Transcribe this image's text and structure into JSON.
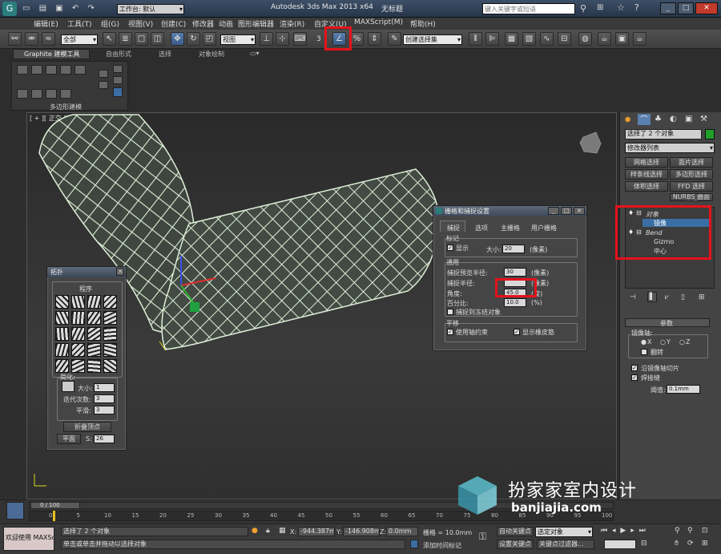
{
  "title_bar": {
    "workspace_label": "工作台: 默认",
    "app_title": "Autodesk 3ds Max  2013 x64",
    "doc_title": "无标题",
    "search_placeholder": "键入关键字或短语"
  },
  "menu": [
    "编辑(E)",
    "工具(T)",
    "组(G)",
    "视图(V)",
    "创建(C)",
    "修改器",
    "动画",
    "图形编辑器",
    "渲染(R)",
    "自定义(U)",
    "MAXScript(M)",
    "帮助(H)"
  ],
  "toolbar": {
    "filter_dropdown": "全部",
    "coord_dropdown": "视图",
    "snap_number": "3",
    "selection_set_dropdown": "创建选择集"
  },
  "ribbon": {
    "tabs": [
      "Graphite 建模工具",
      "自由形式",
      "选择",
      "对象绘制"
    ],
    "panel_label": "多边形建模"
  },
  "viewport": {
    "label": "[ + ][ 正交 ][ 真实 + 边面 ]"
  },
  "topology_panel": {
    "title": "拓扑",
    "section": "程序",
    "simplify_label": "简化:",
    "size_label": "大小:",
    "size_value": "1",
    "iter_label": "迭代次数:",
    "iter_value": "3",
    "smooth_label": "平滑:",
    "smooth_value": "3",
    "collapse_btn": "折叠顶点",
    "plane_btn": "平面",
    "s_label": "S:",
    "s_value": "26"
  },
  "grid_dialog": {
    "title": "栅格和捕捉设置",
    "tabs": [
      "捕捉",
      "选项",
      "主栅格",
      "用户栅格"
    ],
    "marker_group": "标记",
    "display_label": "显示",
    "size_label": "大小:",
    "size_value": "20",
    "size_unit": "(像素)",
    "general_group": "通用",
    "preview_radius_label": "捕捉预览半径:",
    "preview_radius_value": "30",
    "preview_unit": "(像素)",
    "snap_radius_label": "捕捉半径:",
    "snap_radius_unit": "(像素)",
    "angle_label": "角度:",
    "angle_value": "45.0",
    "angle_unit": "(度)",
    "percent_label": "百分比:",
    "percent_value": "10.0",
    "percent_unit": "(%)",
    "frozen_label": "捕捉到冻结对象",
    "move_group": "平移",
    "use_axis_label": "使用轴约束",
    "rubber_label": "显示橡皮筋"
  },
  "command_panel": {
    "selection_text": "选择了 2 个对象",
    "modifier_list": "修改器列表",
    "buttons": [
      "网格选择",
      "面片选择",
      "样条线选择",
      "多边形选择",
      "体积选择",
      "FFD 选择",
      "NURBS 曲面选择"
    ],
    "stack": {
      "object_label": "对象",
      "mirror_label": "镜像",
      "bend_label": "Bend",
      "gizmo_label": "Gizmo",
      "center_label": "中心"
    },
    "params_title": "参数",
    "mirror_axis_label": "镜像轴:",
    "axes": [
      "X",
      "Y",
      "Z"
    ],
    "flip_label": "翻转",
    "slice_label": "沿镜像轴切片",
    "weld_label": "焊接缝",
    "threshold_label": "阈值:",
    "threshold_value": "0.1mm"
  },
  "timeline": {
    "frame_display": "0 / 100",
    "ticks": [
      "0",
      "5",
      "10",
      "15",
      "20",
      "25",
      "30",
      "35",
      "40",
      "45",
      "50",
      "55",
      "60",
      "65",
      "70",
      "75",
      "80",
      "85",
      "90",
      "95",
      "100"
    ]
  },
  "status": {
    "welcome": "欢迎使用 MAXSc",
    "selected": "选择了 2 个对象",
    "prompt": "单击或单击并拖动以选择对象",
    "x_label": "X:",
    "x_value": "-944.387m",
    "y_label": "Y:",
    "y_value": "-146.908m",
    "z_label": "Z:",
    "z_value": "0.0mm",
    "grid_label": "栅格 = 10.0mm",
    "add_time_tag": "添加时间标记",
    "auto_key": "自动关键点",
    "set_key": "设置关键点",
    "selected_dropdown": "选定对象",
    "key_filter": "关键点过滤器..."
  },
  "watermark": {
    "name": "扮家家室内设计",
    "url": "banjiajia.com"
  },
  "colors": {
    "highlight_red": "#e5121b",
    "mesh": "#d7ecd2",
    "selection_blue": "#3a6ea5"
  }
}
